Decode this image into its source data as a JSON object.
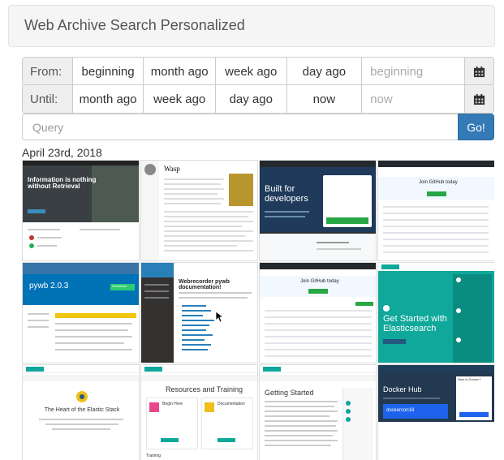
{
  "header": {
    "title": "Web Archive Search Personalized"
  },
  "from_row": {
    "label": "From:",
    "options": [
      "beginning",
      "month ago",
      "week ago",
      "day ago"
    ],
    "input_placeholder": "beginning"
  },
  "until_row": {
    "label": "Until:",
    "options": [
      "month ago",
      "week ago",
      "day ago",
      "now"
    ],
    "input_placeholder": "now"
  },
  "search": {
    "placeholder": "Query",
    "button_label": "Go!"
  },
  "results": {
    "date_heading": "April 23rd, 2018",
    "thumbnails": {
      "t1": "Information is nothing without Retrieval",
      "t2": "Wasp",
      "t3": "Built for developers",
      "t4": "Join GitHub today",
      "t5": "pywb 2.0.3",
      "t6": "Webrecorder pywb documentation!",
      "t7": "Join GitHub today",
      "t8": "Get Started with Elasticsearch",
      "t9": "The Heart of the Elastic Stack",
      "t10": "Resources and Training",
      "t11": "Getting Started",
      "t12": "Docker Hub",
      "t5_button": "Download",
      "t10_sub1": "Begin Here",
      "t10_sub2": "Documentation",
      "t10_foot": "Training",
      "t12_side": "New to Docker?",
      "t12_badge": "dockercon18"
    }
  },
  "colors": {
    "accent": "#337ab7",
    "elastic_teal": "#0fa89b",
    "github_dark": "#24292e",
    "docker_blue": "#1d63ed"
  },
  "icons": {
    "calendar": "calendar-icon",
    "cursor": "mouse-cursor-icon"
  }
}
